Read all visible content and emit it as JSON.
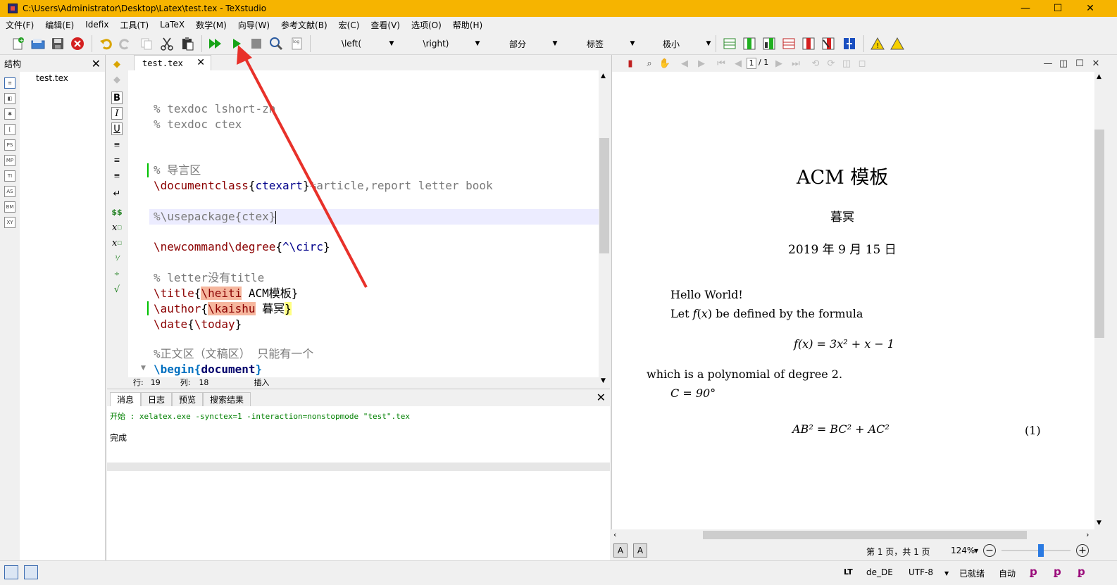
{
  "window": {
    "title": "C:\\Users\\Administrator\\Desktop\\Latex\\test.tex - TeXstudio",
    "minimize": "—",
    "maximize": "☐",
    "close": "✕"
  },
  "menu": [
    "文件(F)",
    "编辑(E)",
    "Idefix",
    "工具(T)",
    "LaTeX",
    "数学(M)",
    "向导(W)",
    "参考文献(B)",
    "宏(C)",
    "查看(V)",
    "选项(O)",
    "帮助(H)"
  ],
  "toolbar": {
    "combo_left": "\\left(",
    "combo_right": "\\right)",
    "combo_section": "部分",
    "combo_label": "标签",
    "combo_size": "极小"
  },
  "structure": {
    "title": "结构",
    "close": "✕",
    "file": "test.tex",
    "side_icons": [
      "≡",
      "◧",
      "✱",
      "⁅",
      "PS",
      "MP",
      "TI",
      "AS",
      "BM",
      "XY"
    ]
  },
  "editor": {
    "tab_name": "test.tex",
    "tab_close": "✕",
    "lines": [
      {
        "text": "% texdoc lshort-zh"
      },
      {
        "text": "% texdoc ctex"
      },
      {
        "text": "% 导言区"
      },
      {
        "cmd": "\\documentclass",
        "open": "{",
        "arg": "ctexart",
        "close": "}",
        "comment": "%article,report letter book"
      },
      {
        "text": "%\\usepackage{ctex}"
      },
      {
        "cmd": "\\newcommand\\degree",
        "open": "{",
        "arg": "^\\circ",
        "close": "}"
      },
      {
        "text": "% letter没有title"
      },
      {
        "cmd": "\\title",
        "open": "{",
        "hl": "\\heiti",
        "arg": " ACM模板",
        "close": "}"
      },
      {
        "cmd": "\\author",
        "open": "{",
        "hl": "\\kaishu",
        "arg": " 暮冥",
        "close": "}"
      },
      {
        "cmd": "\\date",
        "open": "{",
        "arg": "\\today",
        "close": "}"
      },
      {
        "text": "%正文区（文稿区） 只能有一个"
      },
      {
        "cmd": "\\begin",
        "open": "{",
        "arg": "document",
        "close": "}"
      }
    ],
    "status": {
      "row_label": "行:",
      "row_value": "19",
      "col_label": "列:",
      "col_value": "18",
      "mode": "插入"
    }
  },
  "messages": {
    "tabs": [
      "消息",
      "日志",
      "预览",
      "搜索结果"
    ],
    "close": "✕",
    "command": "开始 : xelatex.exe -synctex=1 -interaction=nonstopmode \"test\".tex",
    "result": "完成"
  },
  "pdf": {
    "page_current": "1",
    "page_total": "/ 1",
    "title": "ACM 模板",
    "author": "暮冥",
    "date": "2019 年 9 月 15 日",
    "para1": "Hello World!",
    "para2_a": "Let ",
    "para2_f": "f",
    "para2_b": "(",
    "para2_x": "x",
    "para2_c": ") be defined by the formula",
    "eq1": "f(x) = 3x² + x − 1",
    "para3": "which is a polynomial of degree 2.",
    "eq2": "C = 90°",
    "eq3": "AB² = BC² + AC²",
    "eq3_num": "(1)",
    "status_pages": "第 1 页，共 1 页",
    "zoom": "124%"
  },
  "statusbar": {
    "lang": "de_DE",
    "encoding": "UTF-8",
    "ready": "已就绪",
    "auto": "自动"
  }
}
